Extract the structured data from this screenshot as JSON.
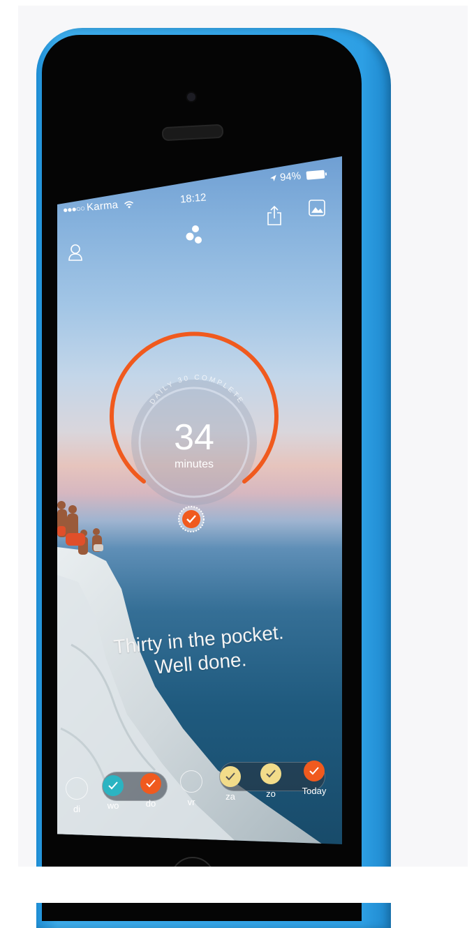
{
  "status_bar": {
    "signal": "●●●○○",
    "carrier": "Karma",
    "time": "18:12",
    "battery": "94%"
  },
  "icons": {
    "profile": "person-icon",
    "logo": "karma-logo-icon",
    "share": "share-icon",
    "photo": "image-icon",
    "wifi": "wifi-icon",
    "location": "location-arrow-icon",
    "battery": "battery-icon",
    "check": "checkmark-icon"
  },
  "progress": {
    "arc_text": "DAILY 30 COMPLETE",
    "value": "34",
    "unit": "minutes",
    "goal_minutes": 30,
    "fraction_complete": 1.0
  },
  "message": {
    "line1": "Thirty in the pocket.",
    "line2": "Well done."
  },
  "week": {
    "days": [
      {
        "label": "di",
        "state": "empty"
      },
      {
        "label": "wo",
        "state": "done-teal"
      },
      {
        "label": "do",
        "state": "done-orange"
      },
      {
        "label": "vr",
        "state": "empty"
      },
      {
        "label": "za",
        "state": "done-yellow"
      },
      {
        "label": "zo",
        "state": "done-yellow"
      },
      {
        "label": "Today",
        "state": "done-orange"
      }
    ]
  },
  "colors": {
    "phone_body": "#2d9fe4",
    "accent_orange": "#f05a1e",
    "teal": "#2bb4c2",
    "yellow": "#f2dc8a"
  }
}
